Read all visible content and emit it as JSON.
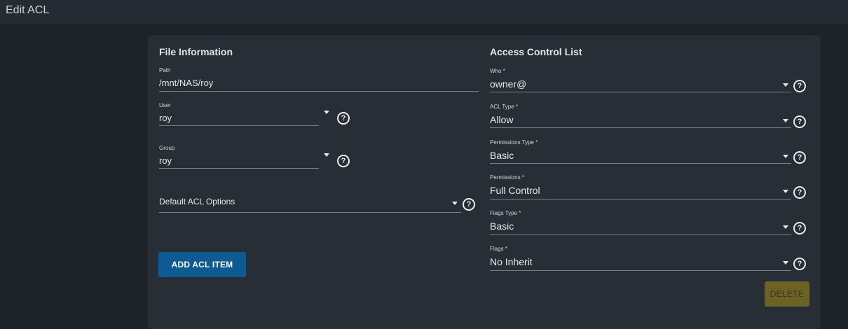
{
  "window": {
    "title": "Edit ACL"
  },
  "file_info": {
    "title": "File Information",
    "path": {
      "label": "Path",
      "value": "/mnt/NAS/roy"
    },
    "user": {
      "label": "User",
      "value": "roy"
    },
    "group": {
      "label": "Group",
      "value": "roy"
    },
    "default_acl_options": {
      "placeholder": "Default ACL Options"
    },
    "add_button": "ADD ACL ITEM"
  },
  "acl": {
    "title": "Access Control List",
    "who": {
      "label": "Who *",
      "value": "owner@"
    },
    "acl_type": {
      "label": "ACL Type *",
      "value": "Allow"
    },
    "permissions_type": {
      "label": "Permissions Type *",
      "value": "Basic"
    },
    "permissions": {
      "label": "Permissions *",
      "value": "Full Control"
    },
    "flags_type": {
      "label": "Flags Type *",
      "value": "Basic"
    },
    "flags": {
      "label": "Flags *",
      "value": "No Inherit"
    },
    "delete_button": "DELETE"
  },
  "icons": {
    "help": "help-circle-icon",
    "dropdown": "caret-down-icon"
  },
  "colors": {
    "primary_button": "#0e5a92",
    "delete_button": "#6b6224",
    "background": "#1e2329",
    "card": "#272e36"
  }
}
